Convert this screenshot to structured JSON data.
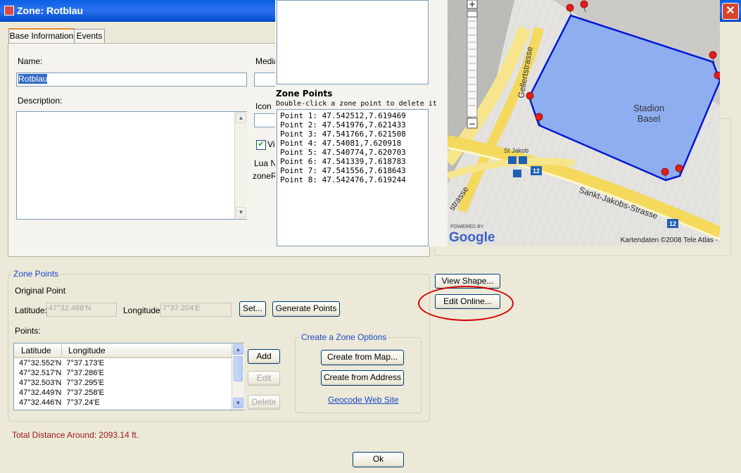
{
  "window": {
    "title": "Zone: Rotblau"
  },
  "tabs": [
    {
      "label": "Base Information"
    },
    {
      "label": "Events"
    }
  ],
  "base": {
    "name_label": "Name:",
    "name_value": "Rotblau",
    "description_label": "Description:",
    "media_label": "Media",
    "icon_label": "Icon",
    "visible_label": "Vi",
    "lua_label": "Lua N",
    "zone_label": "zoneR"
  },
  "popup": {
    "title": "Zone Points",
    "hint": "Double-click a zone point to delete it",
    "points": [
      "Point 1: 47.542512,7.619469",
      "Point 2: 47.541976,7.621433",
      "Point 3: 47.541766,7.621508",
      "Point 4: 47.54081,7.620918",
      "Point 5: 47.540774,7.620703",
      "Point 6: 47.541339,7.618783",
      "Point 7: 47.541556,7.618643",
      "Point 8: 47.542476,7.619244"
    ]
  },
  "map": {
    "street1": "Gellertstrasse",
    "street2": "Sankt-Jakobs-Strasse",
    "street3": "strasse",
    "stadium_line1": "Stadion",
    "stadium_line2": "Basel",
    "stop": "St Jakob",
    "route1": "12",
    "route2": "12",
    "powered": "POWERED BY",
    "logo": "Google",
    "copyright": "Kartendaten ©2008 Tele Atlas -",
    "zoom_in": "+",
    "zoom_out": "−"
  },
  "zone_points": {
    "group_label": "Zone Points",
    "original_point": "Original Point",
    "latitude_label": "Latitude:",
    "latitude_value": "47°32.488'N",
    "longitude_label": "Longitude",
    "longitude_value": "7°37.204'E",
    "set_button": "Set...",
    "generate_button": "Generate Points",
    "points_label": "Points:",
    "columns": [
      "Latitude",
      "Longitude"
    ],
    "rows": [
      [
        "47°32.552'N",
        "7°37.173'E"
      ],
      [
        "47°32.517'N",
        "7°37.286'E"
      ],
      [
        "47°32.503'N",
        "7°37.295'E"
      ],
      [
        "47°32.449'N",
        "7°37.258'E"
      ],
      [
        "47°32.446'N",
        "7°37.24'E"
      ]
    ],
    "add_button": "Add",
    "edit_button": "Edit",
    "delete_button": "Delete"
  },
  "create_options": {
    "group_label": "Create a Zone Options",
    "from_map": "Create from Map...",
    "from_address": "Create from Address",
    "geocode_link": "Geocode Web Site"
  },
  "right_buttons": {
    "view_shape": "View Shape...",
    "edit_online": "Edit Online..."
  },
  "total_distance": "Total Distance Around: 2093.14 ft.",
  "ok_button": "Ok",
  "colors": {
    "titlebar": "#0a5fe3",
    "highlight_circle": "#d40000",
    "polygon_stroke": "#0018d6",
    "polygon_fill": "#8eaef0",
    "link": "#1a46c8"
  }
}
